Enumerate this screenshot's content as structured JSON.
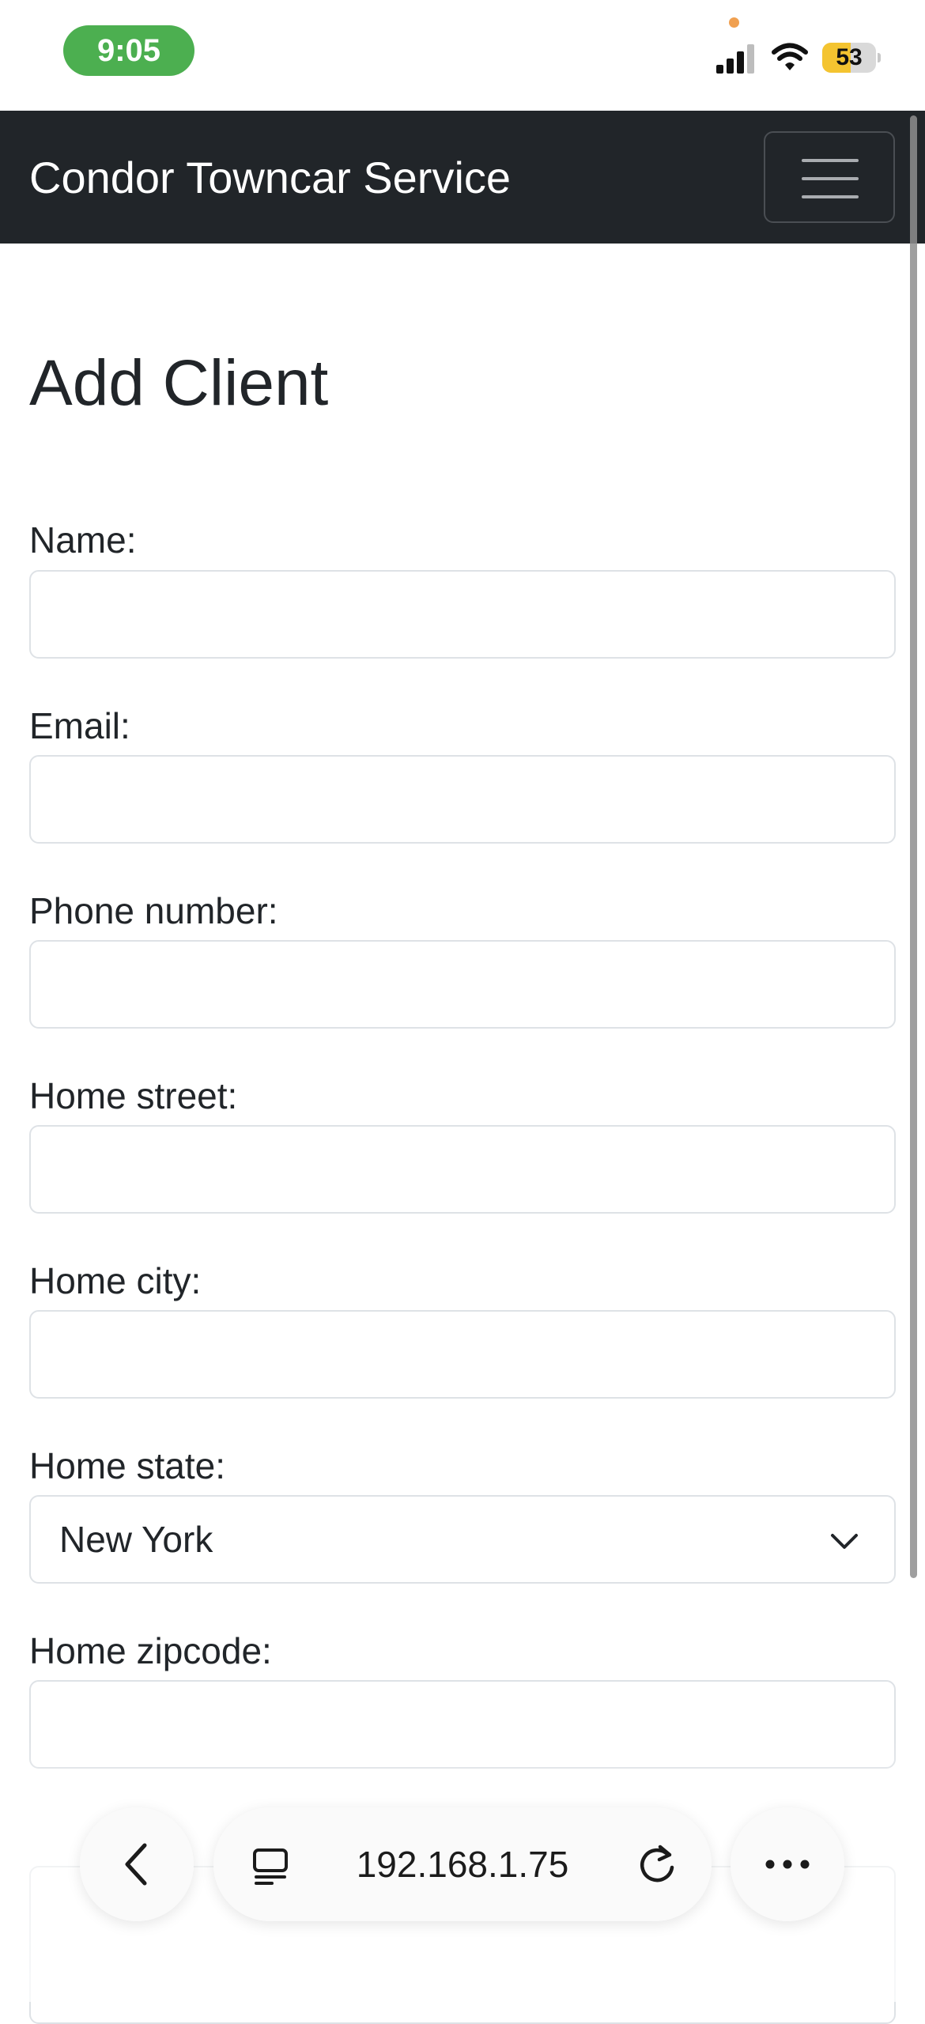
{
  "status_bar": {
    "time": "9:05",
    "battery_level": "53",
    "battery_fraction": 0.53,
    "privacy_dot_color": "#f0a050"
  },
  "navbar": {
    "brand": "Condor Towncar Service",
    "menu_icon": "hamburger-icon"
  },
  "page": {
    "title": "Add Client"
  },
  "form": {
    "name": {
      "label": "Name:",
      "value": ""
    },
    "email": {
      "label": "Email:",
      "value": ""
    },
    "phone": {
      "label": "Phone number:",
      "value": ""
    },
    "home_street": {
      "label": "Home street:",
      "value": ""
    },
    "home_city": {
      "label": "Home city:",
      "value": ""
    },
    "home_state": {
      "label": "Home state:",
      "value": "New York"
    },
    "home_zipcode": {
      "label": "Home zipcode:",
      "value": ""
    }
  },
  "browser": {
    "url": "192.168.1.75",
    "icons": {
      "back": "chevron-left-icon",
      "tabs": "tabs-icon",
      "reload": "reload-icon",
      "more": "more-icon"
    }
  },
  "colors": {
    "navbar_bg": "#212529",
    "status_time_bg": "#4caf50",
    "battery_fill": "#f4c430",
    "input_border": "#dee2e6",
    "text": "#212529"
  }
}
